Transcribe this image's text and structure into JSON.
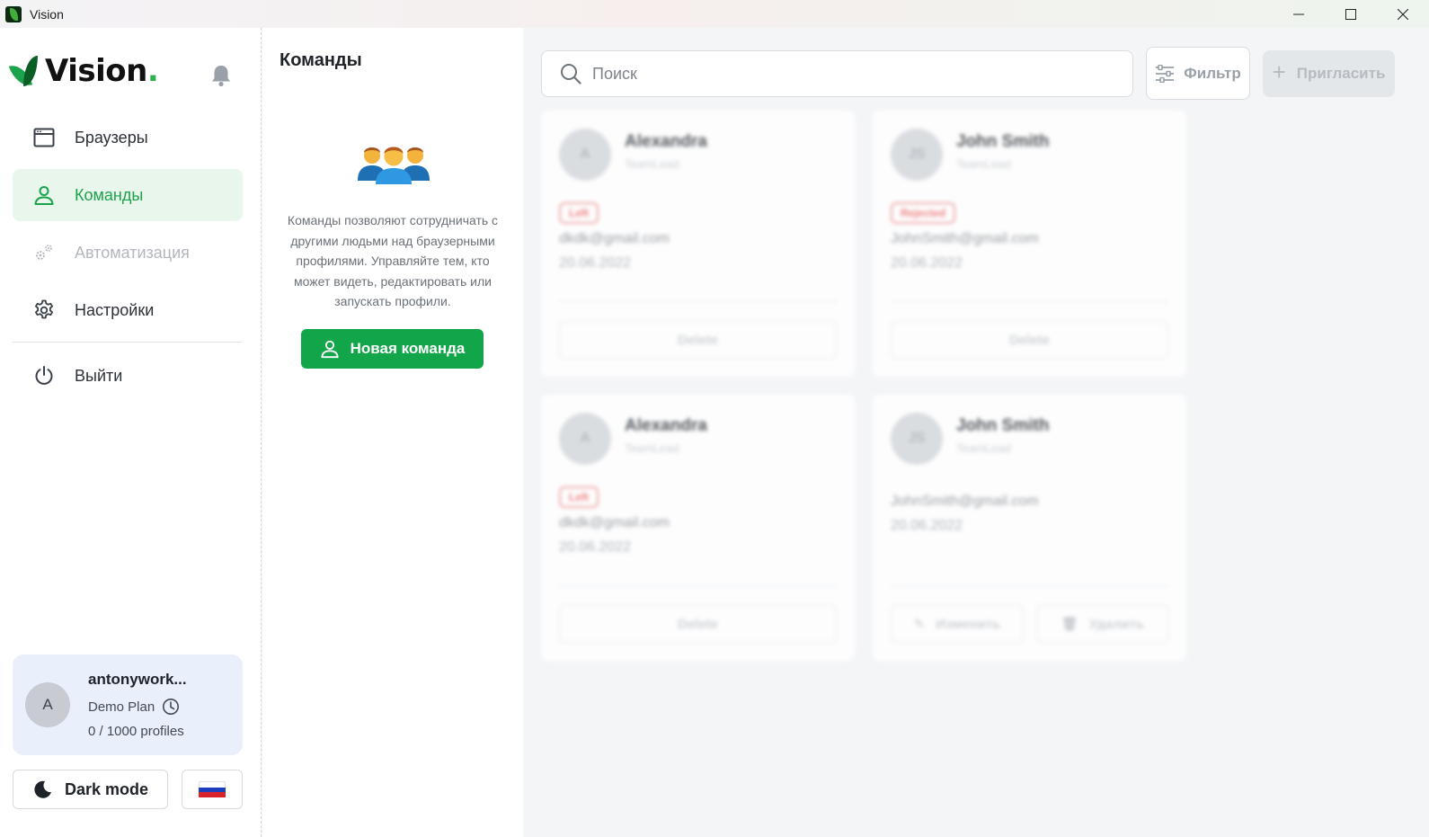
{
  "window": {
    "title": "Vision",
    "controls": {
      "minimize": "—",
      "maximize": "☐",
      "close": "✕"
    }
  },
  "sidebar": {
    "logo_text": "Vision",
    "logo_dot": ".",
    "nav": [
      {
        "label": "Браузеры",
        "icon": "browser-window-icon",
        "state": "normal"
      },
      {
        "label": "Команды",
        "icon": "user-icon",
        "state": "active"
      },
      {
        "label": "Автоматизация",
        "icon": "gears-icon",
        "state": "disabled"
      },
      {
        "label": "Настройки",
        "icon": "gear-icon",
        "state": "normal"
      },
      {
        "label": "Выйти",
        "icon": "power-icon",
        "state": "normal"
      }
    ],
    "user": {
      "avatar_letter": "A",
      "name": "antonywork...",
      "plan": "Demo Plan",
      "profiles": "0 / 1000 profiles"
    },
    "dark_mode_label": "Dark mode",
    "language_flag": "ru-flag"
  },
  "panel": {
    "title": "Команды",
    "description": "Команды позволяют сотрудничать с другими людьми над браузерными профилями. Управляйте тем, кто может видеть, редактировать или запускать профили.",
    "new_team_button": "Новая команда"
  },
  "toolbar": {
    "search_placeholder": "Поиск",
    "filter_label": "Фильтр",
    "invite_label": "Пригласить"
  },
  "members": [
    {
      "initials": "A",
      "name": "Alexandra",
      "role": "TeamLead",
      "badge": "Left",
      "email": "dkdk@gmail.com",
      "date": "20.06.2022",
      "action": "Delete"
    },
    {
      "initials": "JS",
      "name": "John Smith",
      "role": "TeamLead",
      "badge": "Rejected",
      "email": "JohnSmith@gmail.com",
      "date": "20.06.2022",
      "action": "Delete"
    },
    {
      "initials": "A",
      "name": "Alexandra",
      "role": "TeamLead",
      "badge": "Left",
      "email": "dkdk@gmail.com",
      "date": "20.06.2022",
      "action": "Delete"
    },
    {
      "initials": "JS",
      "name": "John Smith",
      "role": "TeamLead",
      "badge": "",
      "email": "JohnSmith@gmail.com",
      "date": "20.06.2022",
      "edit_label": "Изменить",
      "remove_label": "Удалить"
    }
  ],
  "colors": {
    "accent": "#13a54a",
    "active_nav_bg": "#e8f6ec",
    "badge_red": "#ee6b6b",
    "user_card_bg": "#e9f0fb"
  }
}
